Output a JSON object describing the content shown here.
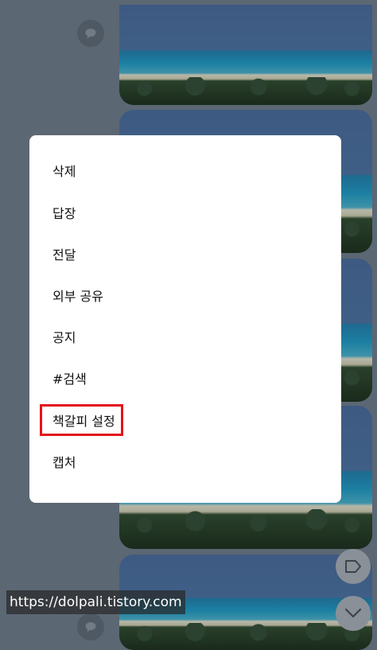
{
  "menu": {
    "items": [
      {
        "label": "삭제"
      },
      {
        "label": "답장"
      },
      {
        "label": "전달"
      },
      {
        "label": "외부 공유"
      },
      {
        "label": "공지"
      },
      {
        "label": "#검색"
      },
      {
        "label": "책갈피 설정",
        "highlighted": true
      },
      {
        "label": "캡처"
      }
    ],
    "highlight_color": "#e3121b"
  },
  "background": {
    "icons": [
      "comment-icon",
      "tag-icon",
      "chevron-down-icon"
    ],
    "overlay_color": "#5b6773"
  },
  "watermark": {
    "text": "https://dolpali.tistory.com"
  }
}
